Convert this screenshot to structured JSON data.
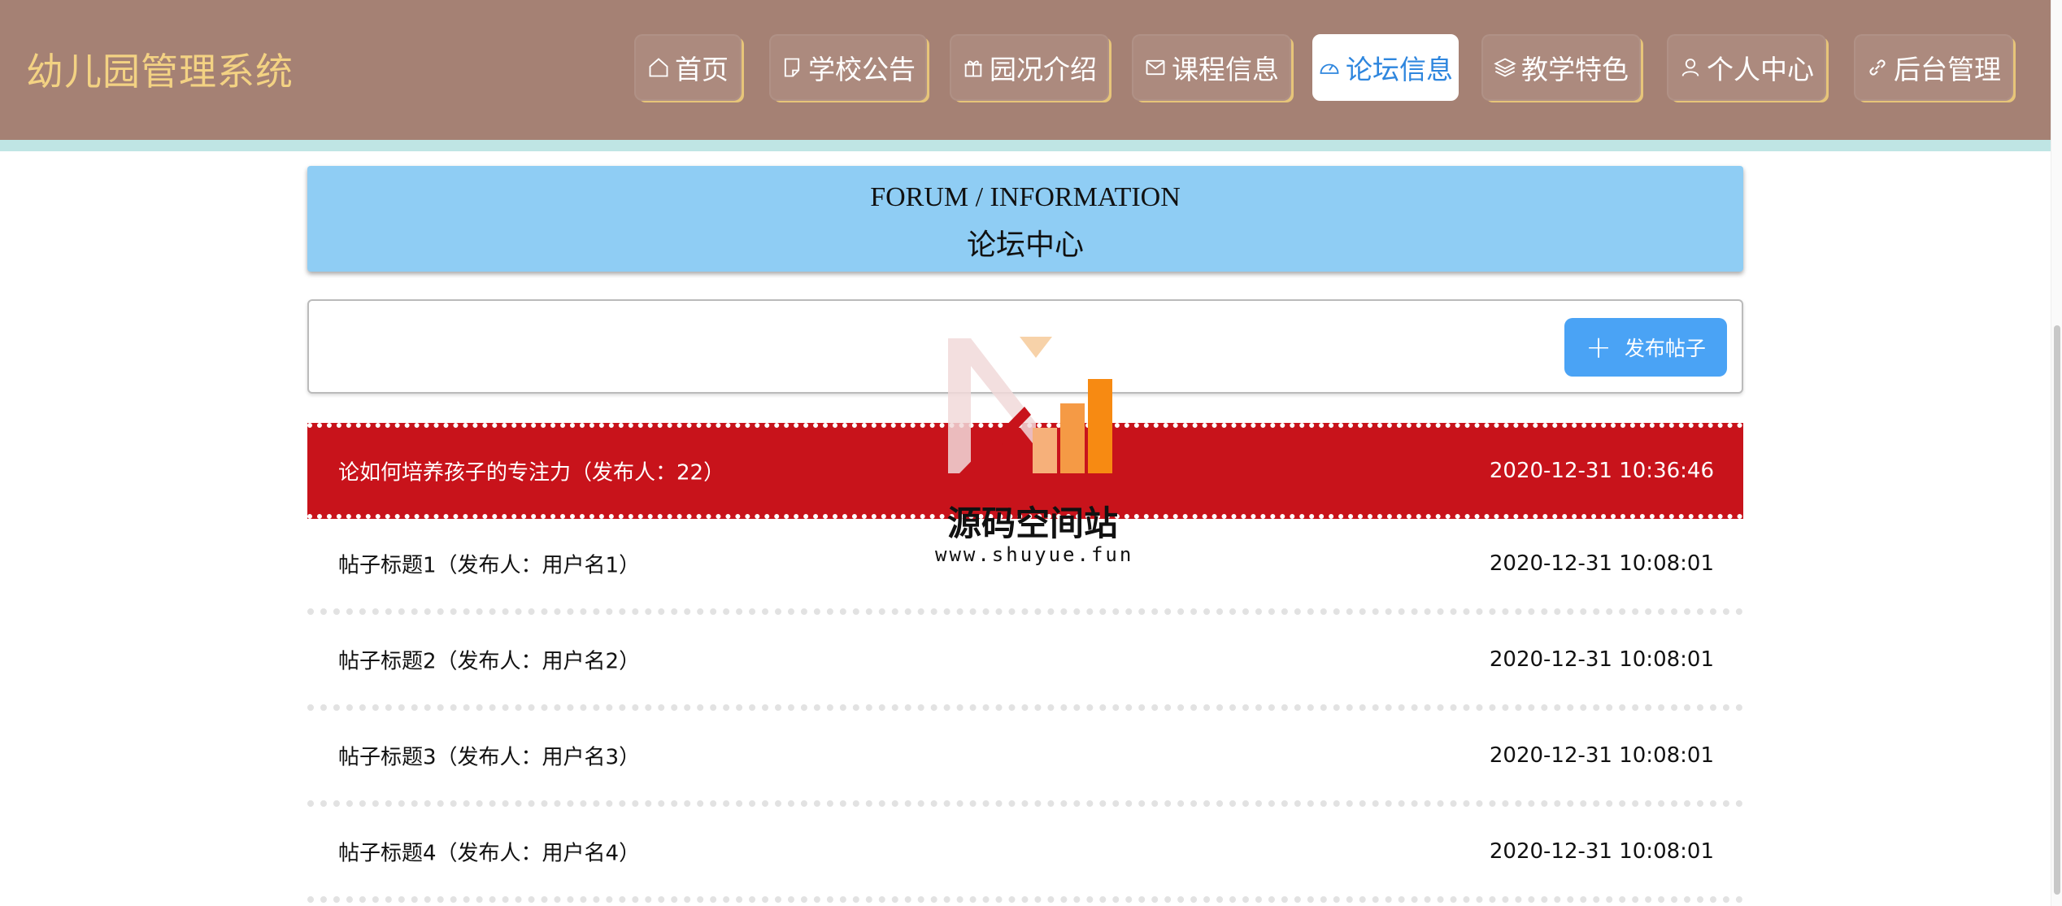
{
  "app": {
    "title": "幼儿园管理系统"
  },
  "nav": {
    "items": [
      {
        "label": "首页",
        "icon": "home-icon"
      },
      {
        "label": "学校公告",
        "icon": "note-icon"
      },
      {
        "label": "园况介绍",
        "icon": "gift-icon"
      },
      {
        "label": "课程信息",
        "icon": "mail-icon"
      },
      {
        "label": "论坛信息",
        "icon": "gauge-icon",
        "active": true
      },
      {
        "label": "教学特色",
        "icon": "layers-icon"
      },
      {
        "label": "个人中心",
        "icon": "user-icon"
      },
      {
        "label": "后台管理",
        "icon": "link-icon"
      }
    ]
  },
  "banner": {
    "en": "FORUM / INFORMATION",
    "cn": "论坛中心"
  },
  "toolbar": {
    "publish_label": "发布帖子"
  },
  "posts": [
    {
      "title": "论如何培养孩子的专注力（发布人：22）",
      "time": "2020-12-31 10:36:46",
      "highlight": true
    },
    {
      "title": "帖子标题1（发布人：用户名1）",
      "time": "2020-12-31 10:08:01"
    },
    {
      "title": "帖子标题2（发布人：用户名2）",
      "time": "2020-12-31 10:08:01"
    },
    {
      "title": "帖子标题3（发布人：用户名3）",
      "time": "2020-12-31 10:08:01"
    },
    {
      "title": "帖子标题4（发布人：用户名4）",
      "time": "2020-12-31 10:08:01"
    }
  ],
  "watermark": {
    "name": "源码空间站",
    "url": "www.shuyue.fun"
  },
  "colors": {
    "header_bg": "#a58174",
    "title_gold": "#f3d283",
    "active_blue": "#2e86de",
    "banner_blue": "#8fcdf4",
    "highlight_red": "#c8131b",
    "button_blue": "#4aa3f5"
  }
}
